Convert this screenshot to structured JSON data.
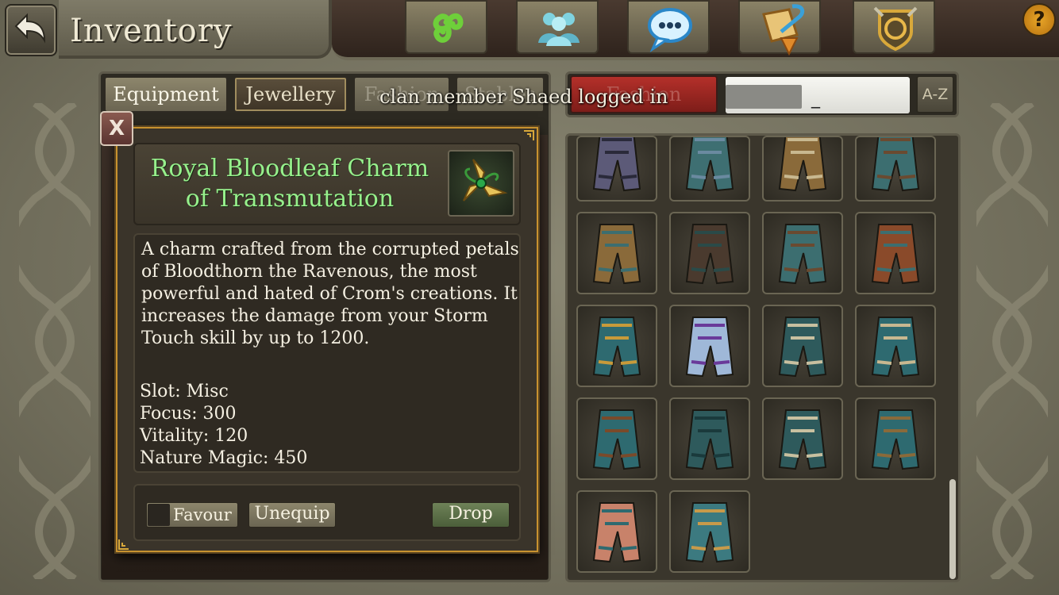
{
  "header": {
    "title": "Inventory",
    "help": "?"
  },
  "top_buttons": [
    {
      "name": "skills-button",
      "icon": "triskele-icon"
    },
    {
      "name": "social-button",
      "icon": "people-icon"
    },
    {
      "name": "chat-button",
      "icon": "speech-bubble-icon"
    },
    {
      "name": "quests-button",
      "icon": "scroll-quill-icon"
    },
    {
      "name": "clan-button",
      "icon": "crest-shield-icon"
    }
  ],
  "tabs": {
    "equipment": "Equipment",
    "jewellery": "Jewellery",
    "fashion": "Fashion",
    "stables": "Stables"
  },
  "filter": {
    "fashion": "Fashion",
    "sort": "A-Z",
    "search_cursor": "_"
  },
  "notification": "clan member Shaed logged in",
  "tooltip": {
    "close": "X",
    "item_name_line1": "Royal Bloodleaf Charm",
    "item_name_line2": "of Transmutation",
    "description": "A charm crafted from the corrupted petals of Bloodthorn the Ravenous, the most powerful and hated of Crom's creations. It increases the damage from your Storm Touch skill by up to 1200.",
    "stats": [
      "Slot: Misc",
      "Focus: 300",
      "Vitality: 120",
      "Nature Magic: 450"
    ],
    "favour": "Favour",
    "unequip": "Unequip",
    "drop": "Drop"
  },
  "colors": {
    "item_name": "#97f08c",
    "accent_gold": "#c8922f",
    "filter_active": "#b4302a"
  },
  "grid_items": [
    "chest-armor-icon",
    "kilt-icon",
    "pauldron-icon",
    "boots-icon",
    "bracer-icon",
    "leggings-icon",
    "boots-icon",
    "glove-icon",
    "tunic-icon",
    "crystal-wand-icon",
    "fur-boots-icon",
    "skirt-icon",
    "tall-boots-icon",
    "plaid-trousers-icon",
    "fur-boots-icon",
    "tabard-icon",
    "tattoo-top-icon",
    "gauntlet-icon"
  ]
}
